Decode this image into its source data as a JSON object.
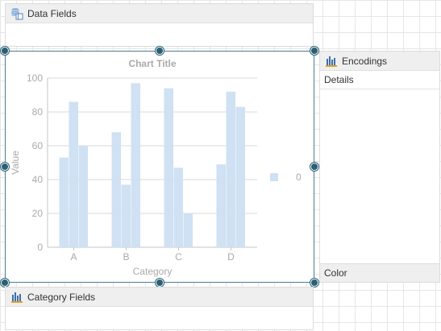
{
  "data_fields": {
    "label": "Data Fields",
    "icon": "database-icon"
  },
  "category_fields": {
    "label": "Category Fields",
    "icon": "bar-chart-icon"
  },
  "encodings": {
    "label": "Encodings",
    "icon": "bar-chart-icon",
    "details_label": "Details",
    "color_label": "Color"
  },
  "colors": {
    "bar": "#cfe1f3",
    "handle": "#2a5f75",
    "frame": "#4a7d92",
    "text": "#aaaaaa"
  },
  "chart_data": {
    "type": "bar",
    "title": "Chart Title",
    "xlabel": "Category",
    "ylabel": "Value",
    "ylim": [
      0,
      100
    ],
    "yticks": [
      0,
      20,
      40,
      60,
      80,
      100
    ],
    "categories": [
      "A",
      "B",
      "C",
      "D"
    ],
    "series": [
      {
        "values": [
          53,
          68,
          94,
          49
        ]
      },
      {
        "values": [
          86,
          37,
          47,
          92
        ]
      },
      {
        "values": [
          60,
          97,
          20,
          83
        ]
      }
    ],
    "legend": {
      "label": "0",
      "position": "right"
    },
    "grid": true
  }
}
